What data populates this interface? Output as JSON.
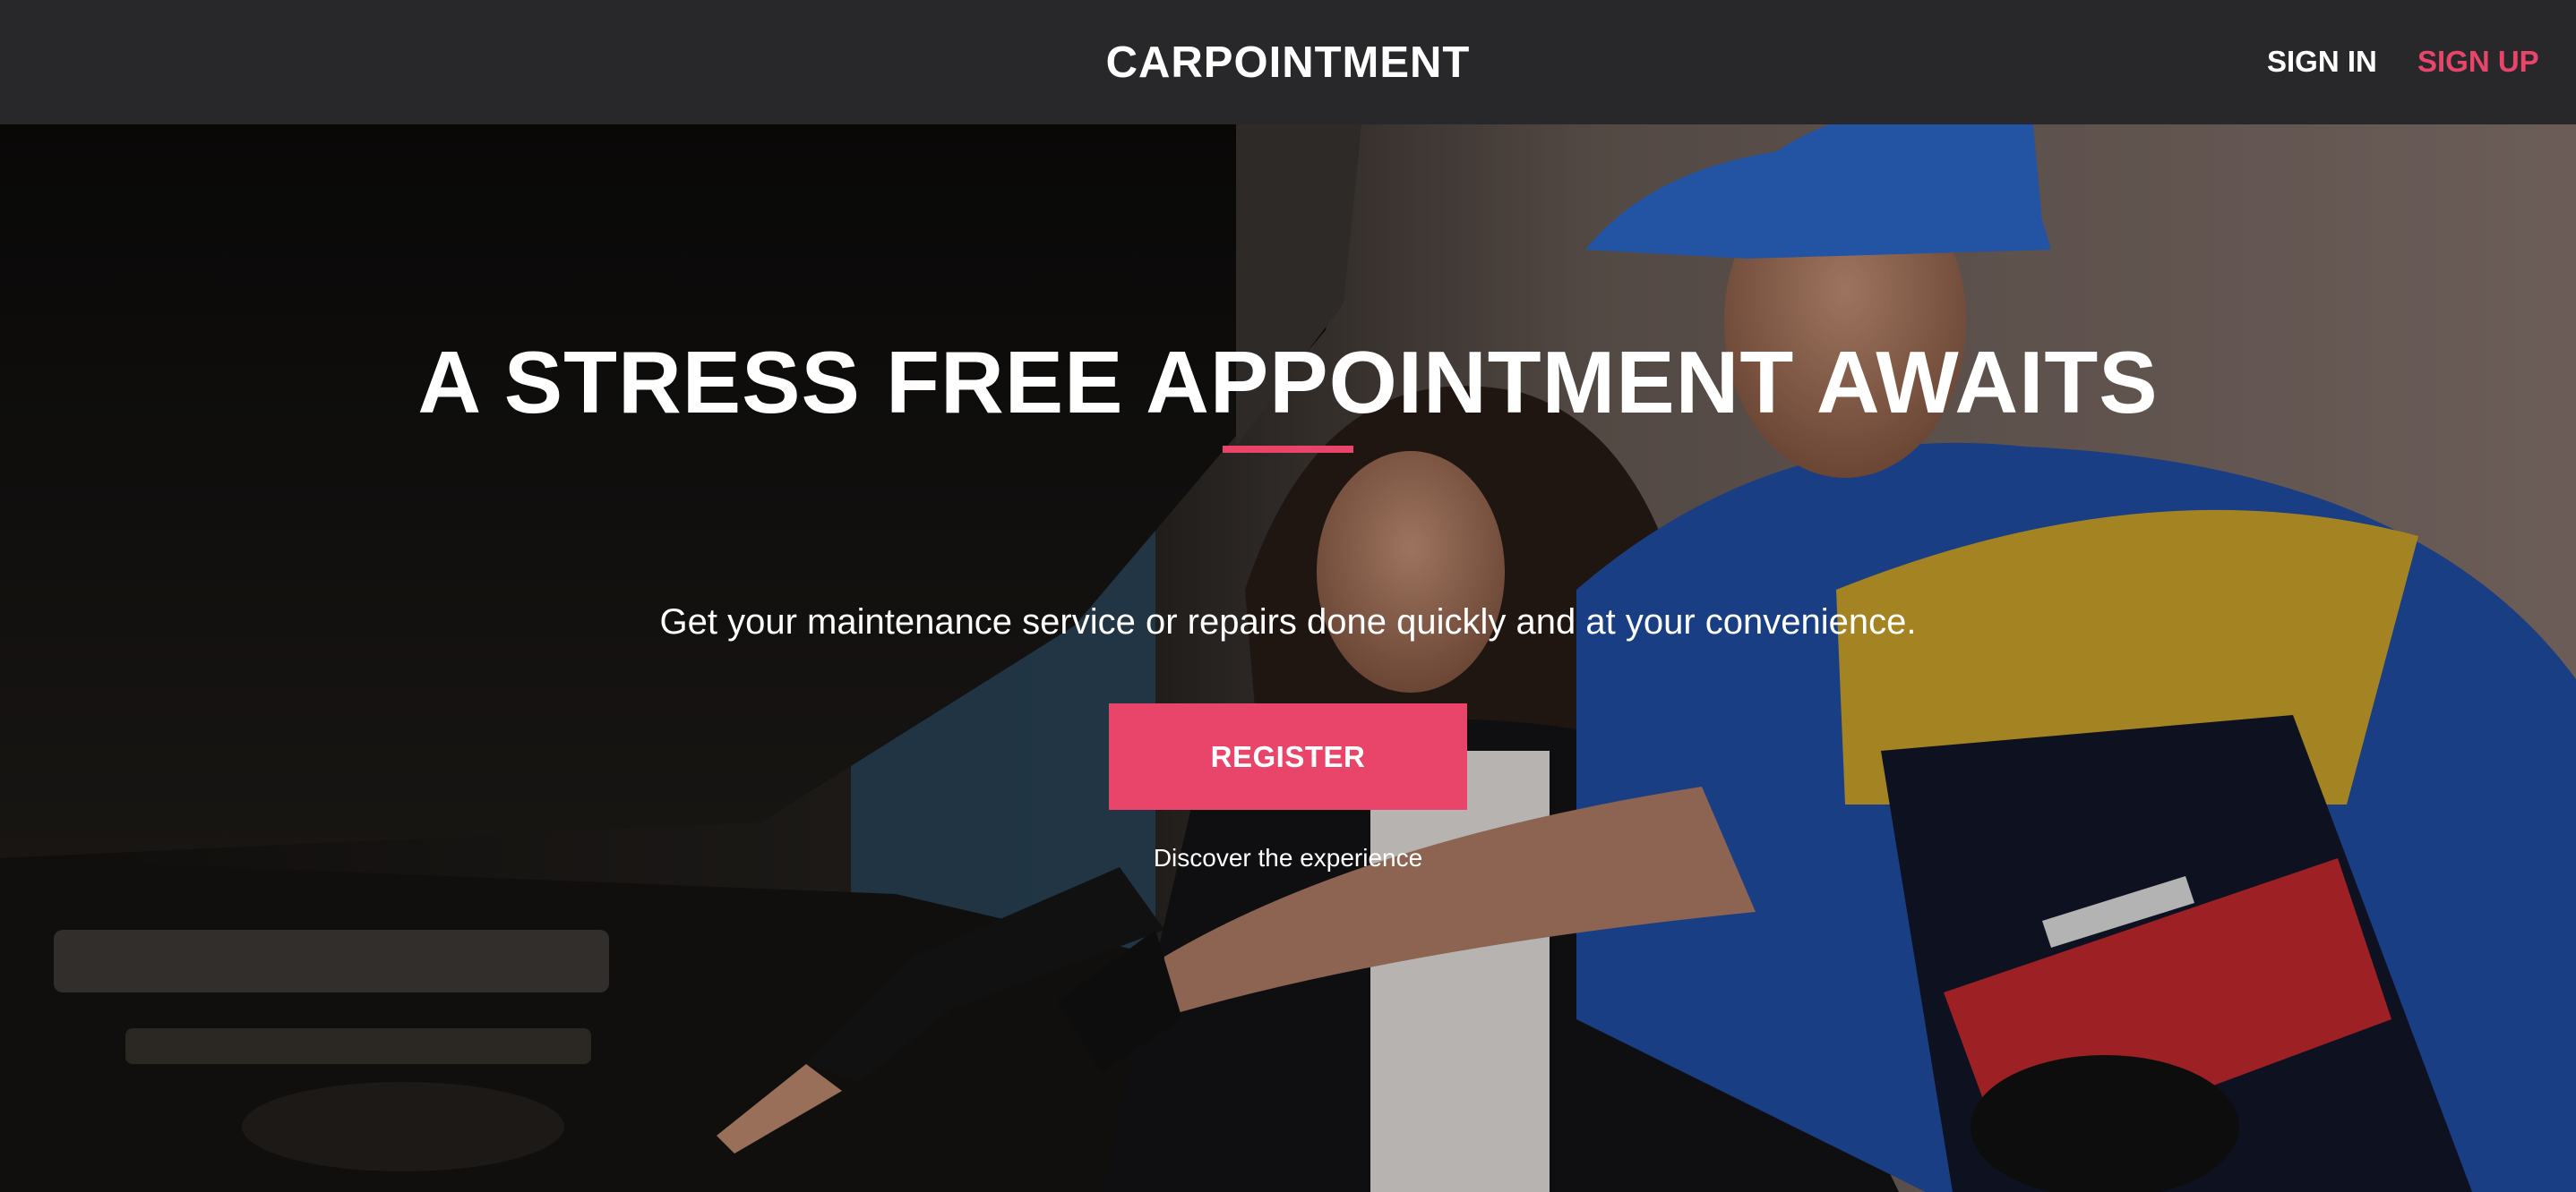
{
  "header": {
    "brand": "CARPOINTMENT",
    "nav": {
      "sign_in": "SIGN IN",
      "sign_up": "SIGN UP"
    }
  },
  "hero": {
    "title": "A STRESS FREE APPOINTMENT AWAITS",
    "subtitle": "Get your maintenance service or repairs done quickly and at your convenience.",
    "cta_label": "REGISTER",
    "cta_caption": "Discover the experience",
    "image_subject": "mechanic and customer inspecting car engine bay"
  },
  "colors": {
    "accent": "#e9456b",
    "header_bg": "#28282a",
    "text": "#ffffff"
  }
}
